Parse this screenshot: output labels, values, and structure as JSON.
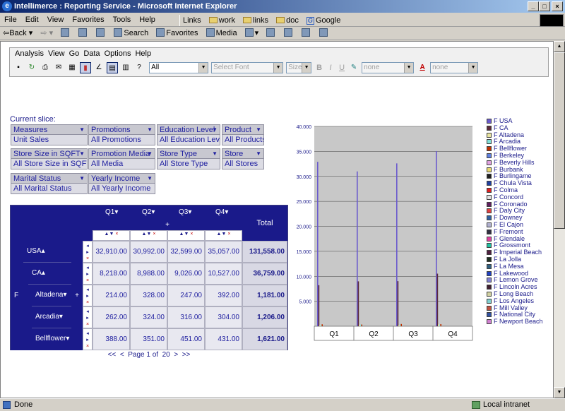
{
  "window": {
    "title": "Intellimerce : Reporting Service - Microsoft Internet Explorer"
  },
  "browser_menu": [
    "File",
    "Edit",
    "View",
    "Favorites",
    "Tools",
    "Help"
  ],
  "links": {
    "label": "Links",
    "items": [
      "work",
      "links",
      "doc",
      "Google"
    ]
  },
  "nav": {
    "back": "Back",
    "search": "Search",
    "favorites": "Favorites",
    "media": "Media"
  },
  "status": {
    "text": "Done",
    "zone": "Local intranet"
  },
  "app_menu": [
    "Analysis",
    "View",
    "Go",
    "Data",
    "Options",
    "Help"
  ],
  "toolbar": {
    "member_select": "All",
    "font_select": "Select Font",
    "size_select": "Size",
    "bold": "B",
    "italic": "I",
    "underline": "U",
    "fill_select": "none",
    "font_color_select": "none",
    "font_color_glyph": "A"
  },
  "slice": {
    "label": "Current slice:",
    "dims": [
      {
        "name": "Measures",
        "value": "Unit Sales"
      },
      {
        "name": "Promotions",
        "value": "All Promotions"
      },
      {
        "name": "Education Level",
        "value": "All Education Level"
      },
      {
        "name": "Product",
        "value": "All Products"
      },
      {
        "name": "Store Size in SQFT",
        "value": "All Store Size in SQFT"
      },
      {
        "name": "Promotion Media",
        "value": "All Media"
      },
      {
        "name": "Store Type",
        "value": "All Store Type"
      },
      {
        "name": "Store",
        "value": "All Stores"
      },
      {
        "name": "Marital Status",
        "value": "All Marital Status"
      },
      {
        "name": "Yearly Income",
        "value": "All Yearly Income"
      }
    ]
  },
  "pivot": {
    "columns": [
      "Q1",
      "Q2",
      "Q3",
      "Q4"
    ],
    "total_label": "Total",
    "expand": "+",
    "page_level": "F",
    "rows": [
      {
        "label": "USA",
        "values": [
          "32,910.00",
          "30,992.00",
          "32,599.00",
          "35,057.00"
        ],
        "total": "131,558.00"
      },
      {
        "label": "CA",
        "values": [
          "8,218.00",
          "8,988.00",
          "9,026.00",
          "10,527.00"
        ],
        "total": "36,759.00"
      },
      {
        "label": "Altadena",
        "values": [
          "214.00",
          "328.00",
          "247.00",
          "392.00"
        ],
        "total": "1,181.00"
      },
      {
        "label": "Arcadia",
        "values": [
          "262.00",
          "324.00",
          "316.00",
          "304.00"
        ],
        "total": "1,206.00"
      },
      {
        "label": "Bellflower",
        "values": [
          "388.00",
          "351.00",
          "451.00",
          "431.00"
        ],
        "total": "1,621.00"
      }
    ],
    "pager": {
      "first": "<<",
      "prev": "<",
      "text": "Page 1 of",
      "current": "20",
      "next": ">",
      "last": ">>"
    }
  },
  "chart_data": {
    "type": "bar",
    "categories": [
      "Q1",
      "Q2",
      "Q3",
      "Q4"
    ],
    "ylim": [
      0,
      40000
    ],
    "yticks": [
      "5.000",
      "10.000",
      "15.000",
      "20.000",
      "25.000",
      "30.000",
      "35.000",
      "40.000"
    ],
    "series": [
      {
        "name": "F USA",
        "color": "#6a5acd",
        "values": [
          32910,
          30992,
          32599,
          35057
        ]
      },
      {
        "name": "F CA",
        "color": "#5a2a3a",
        "values": [
          8218,
          8988,
          9026,
          10527
        ]
      },
      {
        "name": "F Altadena",
        "color": "#e8e4a0",
        "values": [
          214,
          328,
          247,
          392
        ]
      },
      {
        "name": "F Arcadia",
        "color": "#80e0d8",
        "values": [
          262,
          324,
          316,
          304
        ]
      },
      {
        "name": "F Bellflower",
        "color": "#c03000",
        "values": [
          388,
          351,
          451,
          431
        ]
      },
      {
        "name": "F Berkeley",
        "color": "#6080e0",
        "values": [
          0,
          0,
          0,
          0
        ]
      },
      {
        "name": "F Beverly Hills",
        "color": "#e0a0e0",
        "values": [
          0,
          0,
          0,
          0
        ]
      },
      {
        "name": "F Burbank",
        "color": "#e8d870",
        "values": [
          0,
          0,
          0,
          0
        ]
      },
      {
        "name": "F Burlingame",
        "color": "#202020",
        "values": [
          0,
          0,
          0,
          0
        ]
      },
      {
        "name": "F Chula Vista",
        "color": "#2040a0",
        "values": [
          0,
          0,
          0,
          0
        ]
      },
      {
        "name": "F Colma",
        "color": "#e02020",
        "values": [
          0,
          0,
          0,
          0
        ]
      },
      {
        "name": "F Concord",
        "color": "#e0e0e0",
        "values": [
          0,
          0,
          0,
          0
        ]
      },
      {
        "name": "F Coronado",
        "color": "#602060",
        "values": [
          0,
          0,
          0,
          0
        ]
      },
      {
        "name": "F Daly City",
        "color": "#e04040",
        "values": [
          0,
          0,
          0,
          0
        ]
      },
      {
        "name": "F Downey",
        "color": "#3060a0",
        "values": [
          0,
          0,
          0,
          0
        ]
      },
      {
        "name": "F El Cajon",
        "color": "#b0b0d0",
        "values": [
          0,
          0,
          0,
          0
        ]
      },
      {
        "name": "F Fremont",
        "color": "#303040",
        "values": [
          0,
          0,
          0,
          0
        ]
      },
      {
        "name": "F Glendale",
        "color": "#e040a0",
        "values": [
          0,
          0,
          0,
          0
        ]
      },
      {
        "name": "F Grossmont",
        "color": "#20c0a0",
        "values": [
          0,
          0,
          0,
          0
        ]
      },
      {
        "name": "F Imperial Beach",
        "color": "#502040",
        "values": [
          0,
          0,
          0,
          0
        ]
      },
      {
        "name": "F La Jolla",
        "color": "#203020",
        "values": [
          0,
          0,
          0,
          0
        ]
      },
      {
        "name": "F La Mesa",
        "color": "#306080",
        "values": [
          0,
          0,
          0,
          0
        ]
      },
      {
        "name": "F Lakewood",
        "color": "#2040c0",
        "values": [
          0,
          0,
          0,
          0
        ]
      },
      {
        "name": "F Lemon Grove",
        "color": "#8080d0",
        "values": [
          0,
          0,
          0,
          0
        ]
      },
      {
        "name": "F Lincoln Acres",
        "color": "#402030",
        "values": [
          0,
          0,
          0,
          0
        ]
      },
      {
        "name": "F Long Beach",
        "color": "#d0d0a0",
        "values": [
          0,
          0,
          0,
          0
        ]
      },
      {
        "name": "F Los Angeles",
        "color": "#80d0d0",
        "values": [
          0,
          0,
          0,
          0
        ]
      },
      {
        "name": "F Mill Valley",
        "color": "#c05040",
        "values": [
          0,
          0,
          0,
          0
        ]
      },
      {
        "name": "F National City",
        "color": "#3050a0",
        "values": [
          0,
          0,
          0,
          0
        ]
      },
      {
        "name": "F Newport Beach",
        "color": "#d080d0",
        "values": [
          0,
          0,
          0,
          0
        ]
      }
    ]
  }
}
